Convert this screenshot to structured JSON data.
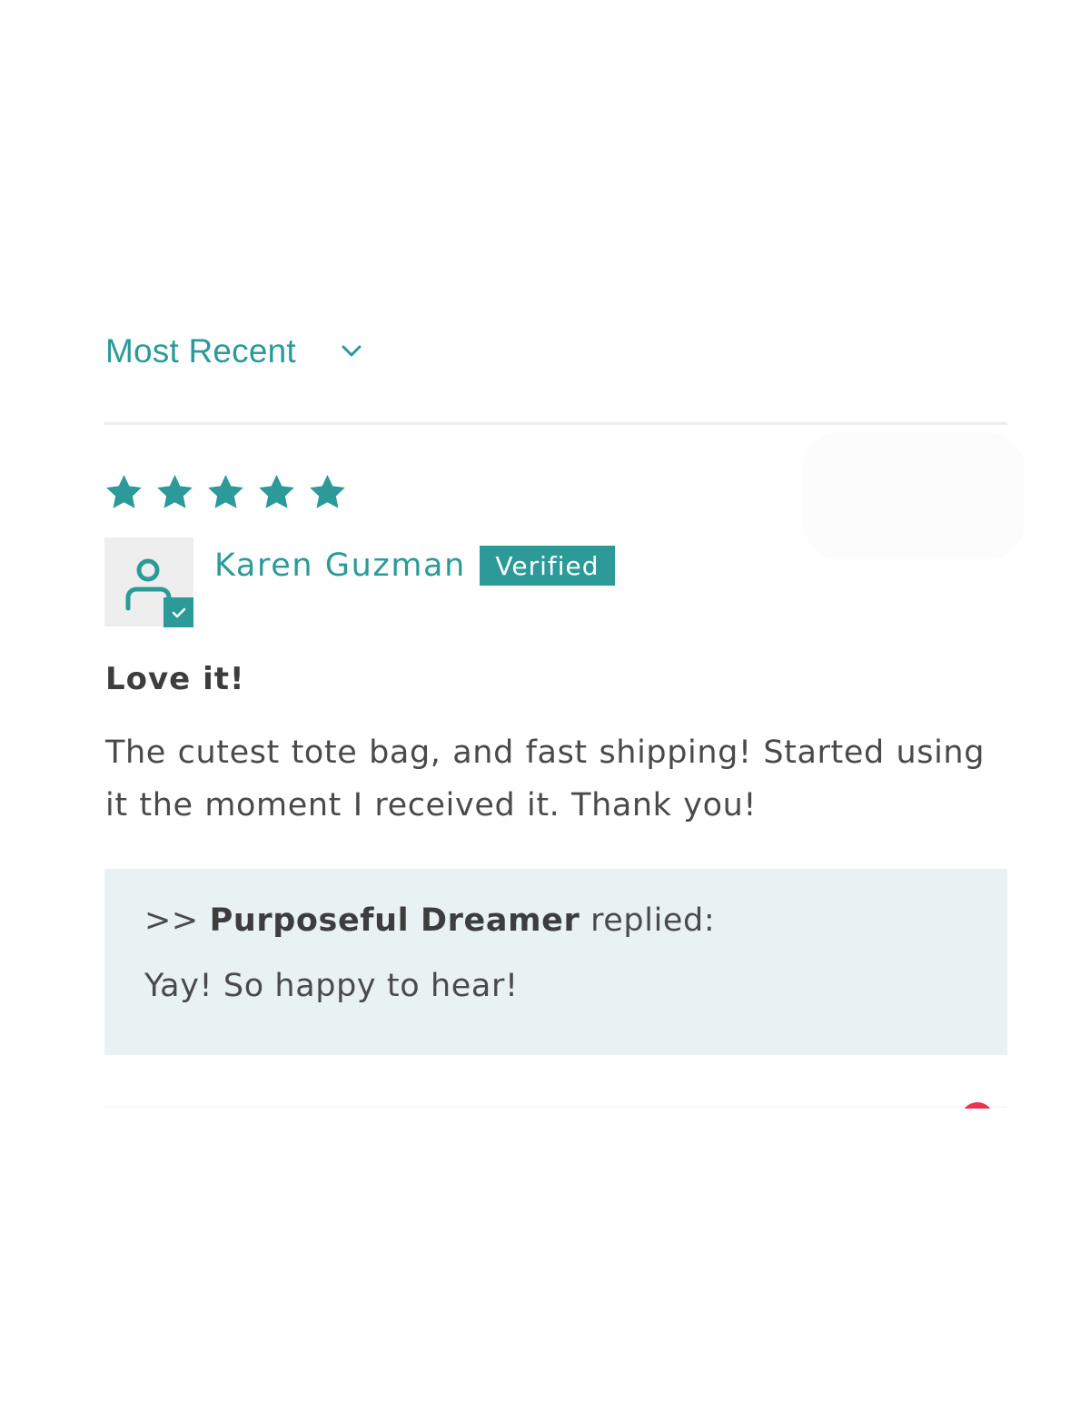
{
  "sort": {
    "selected": "Most Recent",
    "icon": "chevron-down-icon"
  },
  "review": {
    "rating": 5,
    "rating_max": 5,
    "author": "Karen Guzman",
    "badge": "Verified",
    "avatar_icon": "user-verified-icon",
    "title": "Love it!",
    "body": "The cutest tote bag, and fast shipping! Started using it the moment I received it. Thank you!",
    "reply": {
      "prefix": ">> ",
      "name": "Purposeful Dreamer",
      "suffix": " replied:",
      "text": "Yay! So happy to hear!"
    }
  },
  "colors": {
    "accent": "#2b9a98",
    "reply_background": "#e9f2f3",
    "text": "#4a4a4a",
    "next_icon": "#e8344d"
  }
}
